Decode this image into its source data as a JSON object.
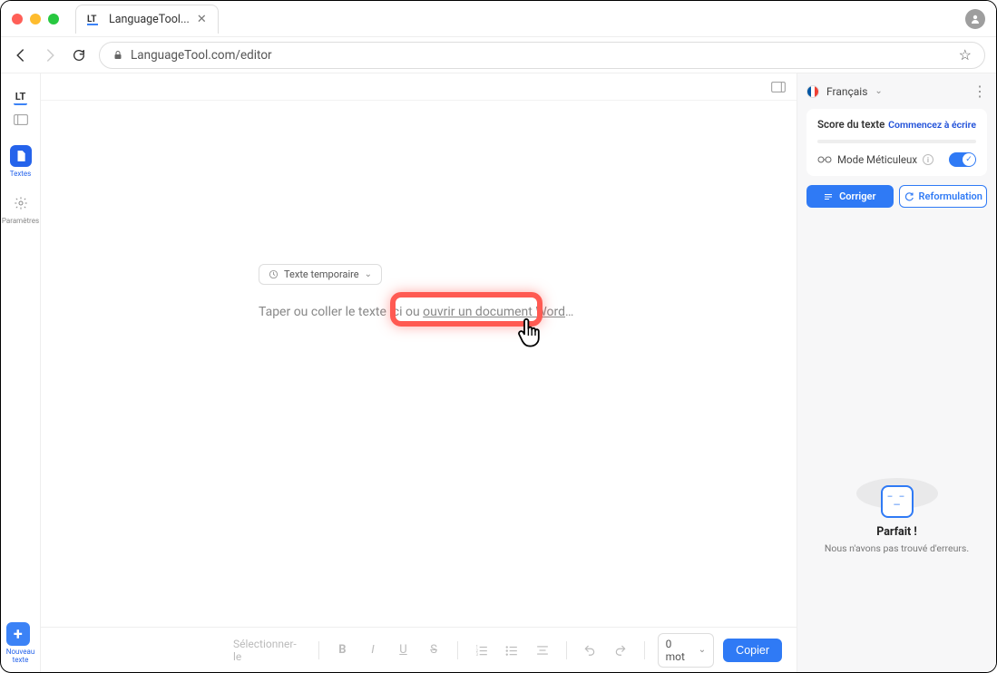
{
  "tab": {
    "title": "LanguageTool..."
  },
  "url": "LanguageTool.com/editor",
  "leftRail": {
    "textes": "Textes",
    "parametres": "Paramètres",
    "nouveau": "Nouveau\ntexte"
  },
  "tempPill": "Texte temporaire",
  "placeholder": {
    "prefix": "Taper ou coller le texte ici ou ",
    "link": "ouvrir un document Word",
    "suffix": "…"
  },
  "bottom": {
    "select": "Sélectionner-le",
    "wordCount": "0 mot",
    "copy": "Copier"
  },
  "right": {
    "language": "Français",
    "scoreTitle": "Score du texte",
    "startLink": "Commencez à écrire",
    "modeLabel": "Mode Méticuleux",
    "correct": "Corriger",
    "reform": "Reformulation",
    "perfectTitle": "Parfait !",
    "perfectSub": "Nous n'avons pas trouvé d'erreurs."
  }
}
